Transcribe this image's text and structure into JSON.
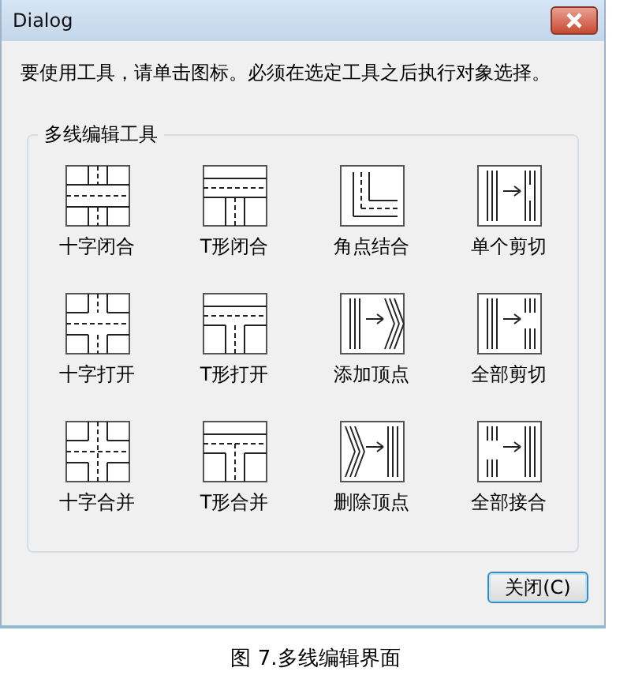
{
  "window": {
    "title": "Dialog"
  },
  "instruction": "要使用工具，请单击图标。必须在选定工具之后执行对象选择。",
  "group": {
    "title": "多线编辑工具",
    "tools": [
      {
        "label": "十字闭合",
        "kind": "cross-closed"
      },
      {
        "label": "T形闭合",
        "kind": "tee-closed"
      },
      {
        "label": "角点结合",
        "kind": "corner"
      },
      {
        "label": "单个剪切",
        "kind": "cut-single"
      },
      {
        "label": "十字打开",
        "kind": "cross-open"
      },
      {
        "label": "T形打开",
        "kind": "tee-open"
      },
      {
        "label": "添加顶点",
        "kind": "add-vertex"
      },
      {
        "label": "全部剪切",
        "kind": "cut-all"
      },
      {
        "label": "十字合并",
        "kind": "cross-merge"
      },
      {
        "label": "T形合并",
        "kind": "tee-merge"
      },
      {
        "label": "删除顶点",
        "kind": "delete-vertex"
      },
      {
        "label": "全部接合",
        "kind": "weld-all"
      }
    ]
  },
  "buttons": [
    "关闭(C)"
  ],
  "caption": "图 7.多线编辑界面"
}
